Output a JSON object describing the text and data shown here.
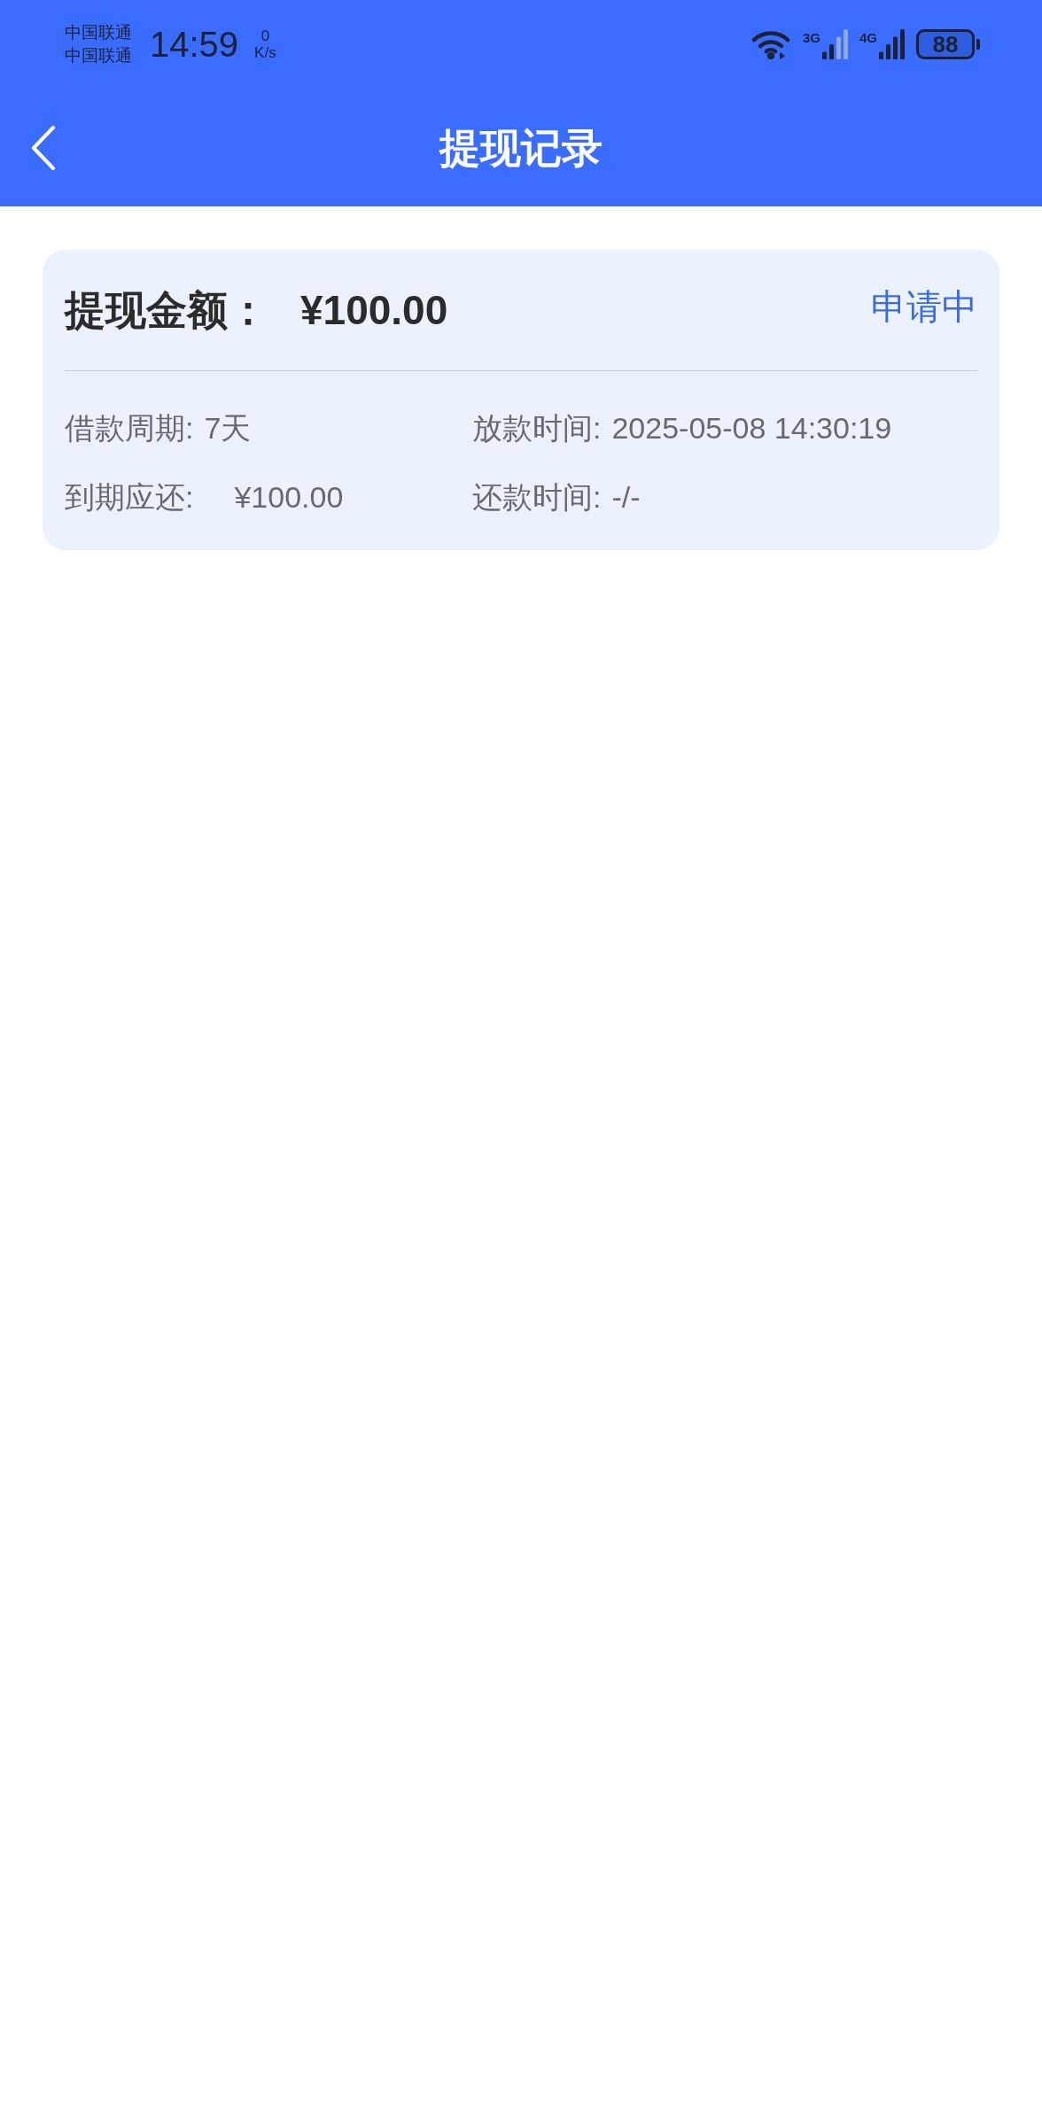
{
  "status_bar": {
    "carriers": [
      "中国联通",
      "中国联通"
    ],
    "time": "14:59",
    "speed_value": "0",
    "speed_unit": "K/s",
    "networks": [
      {
        "label": "3G"
      },
      {
        "label": "4G"
      }
    ],
    "battery": "88"
  },
  "header": {
    "title": "提现记录"
  },
  "records": [
    {
      "amount_label": "提现金额：",
      "amount": "¥100.00",
      "status": "申请中",
      "fields": [
        {
          "label": "借款周期:",
          "value": "7天"
        },
        {
          "label": "放款时间:",
          "value": "2025-05-08 14:30:19"
        },
        {
          "label": "到期应还:",
          "value": "¥100.00"
        },
        {
          "label": "还款时间:",
          "value": "-/-"
        }
      ]
    }
  ]
}
